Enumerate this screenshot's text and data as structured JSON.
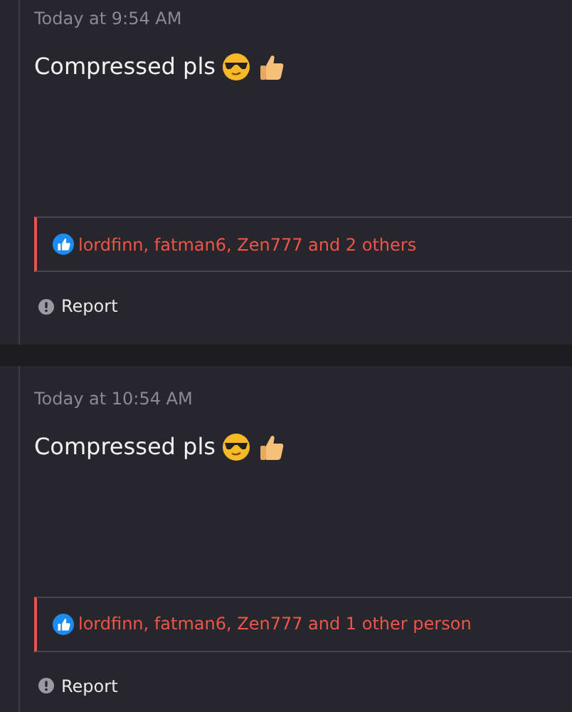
{
  "posts": [
    {
      "timestamp": "Today at 9:54 AM",
      "message": "Compressed pls",
      "reactions": "lordfinn, fatman6, Zen777 and 2 others",
      "report": "Report"
    },
    {
      "timestamp": "Today at 10:54 AM",
      "message": "Compressed pls",
      "reactions": "lordfinn, fatman6, Zen777 and 1 other person",
      "report": "Report"
    }
  ]
}
